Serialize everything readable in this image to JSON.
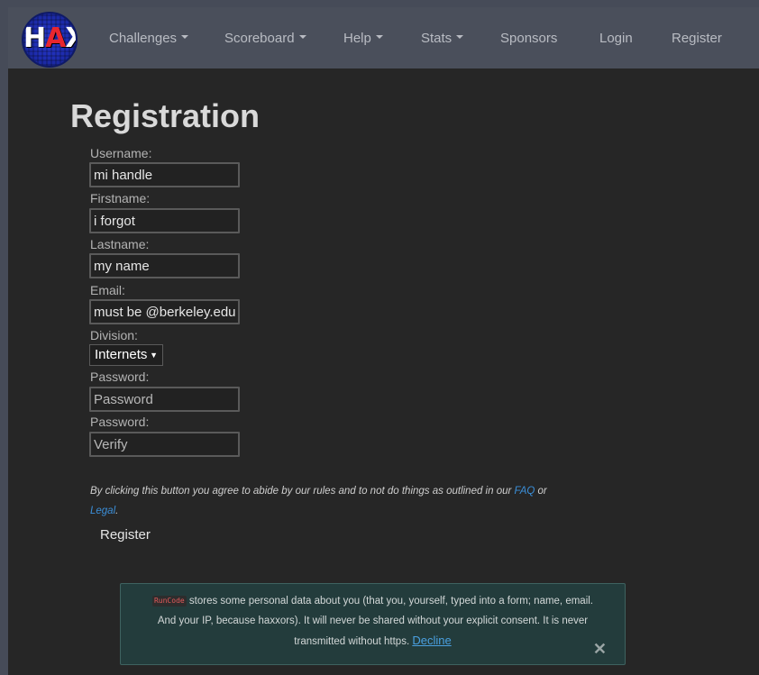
{
  "nav": {
    "logo_text_left": "H",
    "logo_text_mid": "A",
    "logo_text_right": "X",
    "items": [
      {
        "label": "Challenges",
        "dropdown": true
      },
      {
        "label": "Scoreboard",
        "dropdown": true
      },
      {
        "label": "Help",
        "dropdown": true
      },
      {
        "label": "Stats",
        "dropdown": true
      },
      {
        "label": "Sponsors",
        "dropdown": false
      },
      {
        "label": "Login",
        "dropdown": false
      },
      {
        "label": "Register",
        "dropdown": false
      }
    ]
  },
  "form": {
    "title": "Registration",
    "username_label": "Username:",
    "username_value": "mi handle",
    "firstname_label": "Firstname:",
    "firstname_value": "i forgot",
    "lastname_label": "Lastname:",
    "lastname_value": "my name",
    "email_label": "Email:",
    "email_value": "must be @berkeley.edu",
    "division_label": "Division:",
    "division_value": "Internets",
    "password_label": "Password:",
    "password_placeholder": "Password",
    "verify_label": "Password:",
    "verify_placeholder": "Verify",
    "terms_text": "By clicking this button you agree to abide by our rules and to not do things as outlined in our",
    "terms_faq": "FAQ",
    "terms_or": "or",
    "terms_legal": "Legal",
    "terms_period": ".",
    "submit_label": "Register"
  },
  "cookie": {
    "brand": "RunCode",
    "text": "stores some personal data about you (that you, yourself, typed into a form; name, email. And your IP, because haxxors). It will never be shared without your explicit consent. It is never transmitted without https.",
    "decline": "Decline",
    "close": "✕"
  },
  "colors": {
    "navbar": "#4a4f5b",
    "page_bg": "#262626",
    "link": "#3b8fd9",
    "cookie_bg": "#233c3c"
  }
}
